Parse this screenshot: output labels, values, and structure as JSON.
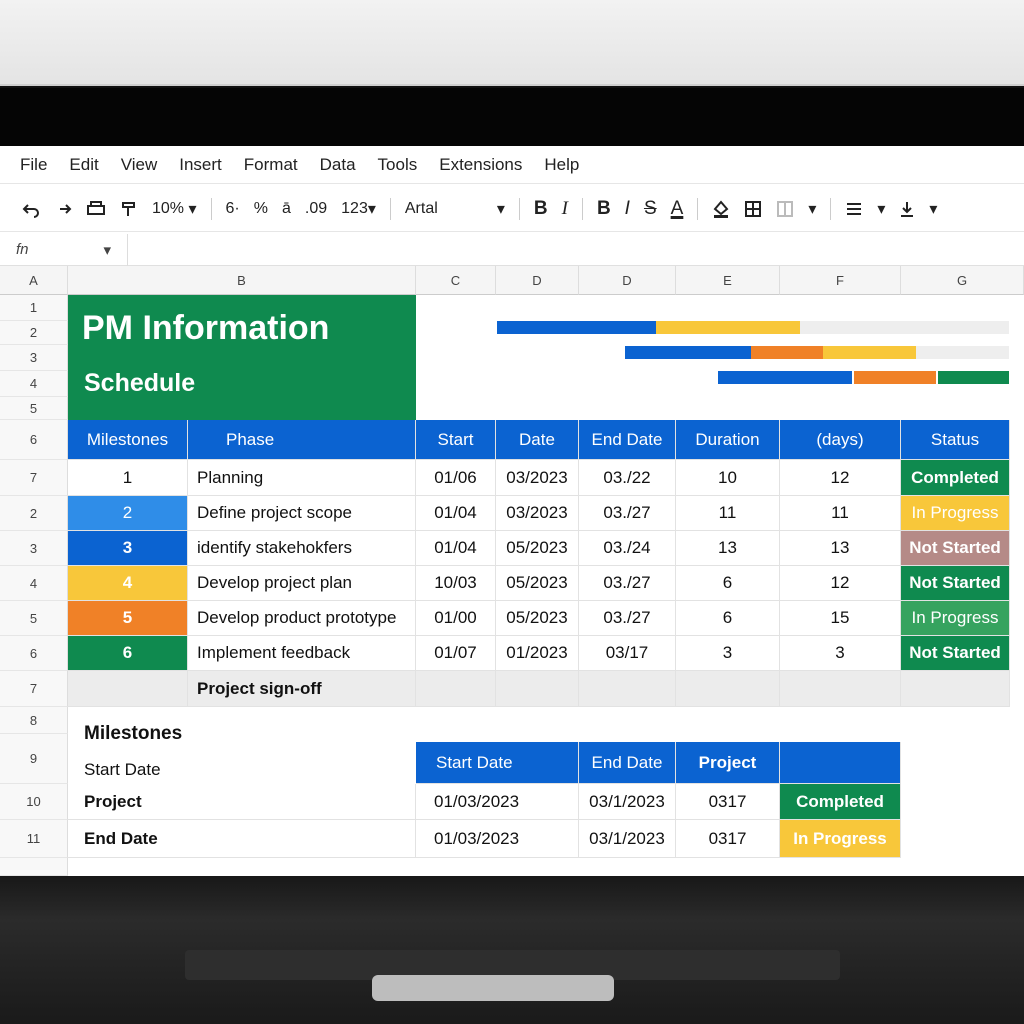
{
  "menu": [
    "File",
    "Edit",
    "View",
    "Insert",
    "Format",
    "Data",
    "Tools",
    "Extensions",
    "Help"
  ],
  "toolbar": {
    "undo_icon": "undo-icon",
    "redo_icon": "redo-icon",
    "zoom": "10%",
    "decimal_dec": "6·",
    "percent": "%",
    "currency": "ā",
    "decimal_inc": ".09",
    "format": "123",
    "font": "Artal",
    "bold": "B",
    "italic": "I",
    "bold2": "B",
    "italic2": "I",
    "strike": "S",
    "textcolor": "A"
  },
  "formula": {
    "namebox": "fn"
  },
  "columns": [
    "A",
    "B",
    "C",
    "D",
    "D",
    "E",
    "F",
    "G"
  ],
  "rows": [
    "1",
    "2",
    "3",
    "4",
    "5",
    "6",
    "7",
    "2",
    "3",
    "4",
    "5",
    "6",
    "7",
    "8",
    "9",
    "10",
    "11"
  ],
  "banner": {
    "title": "PM Information",
    "subtitle": "Schedule"
  },
  "table": {
    "headers": [
      "Milestones",
      "Phase",
      "Start",
      "Date",
      "End Date",
      "Duration",
      "(days)",
      "Status"
    ],
    "rows": [
      {
        "num": "1",
        "phase": "Planning",
        "start": "01/06",
        "date": "03/2023",
        "end": "03./22",
        "dur": "10",
        "days": "12",
        "status": "Completed"
      },
      {
        "num": "2",
        "phase": "Define project scope",
        "start": "01/04",
        "date": "03/2023",
        "end": "03./27",
        "dur": "11",
        "days": "11",
        "status": "In Progress"
      },
      {
        "num": "3",
        "phase": "identify stakehokfers",
        "start": "01/04",
        "date": "05/2023",
        "end": "03./24",
        "dur": "13",
        "days": "13",
        "status": "Not Started"
      },
      {
        "num": "4",
        "phase": "Develop project plan",
        "start": "10/03",
        "date": "05/2023",
        "end": "03./27",
        "dur": "6",
        "days": "12",
        "status": "Not Started"
      },
      {
        "num": "5",
        "phase": "Develop product prototype",
        "start": "01/00",
        "date": "05/2023",
        "end": "03./27",
        "dur": "6",
        "days": "15",
        "status": "In Progress"
      },
      {
        "num": "6",
        "phase": "Implement feedback",
        "start": "01/07",
        "date": "01/2023",
        "end": "03/17",
        "dur": "3",
        "days": "3",
        "status": "Not Started"
      }
    ],
    "signoff": "Project sign-off"
  },
  "summary": {
    "title": "Milestones",
    "label_start": "Start Date",
    "headers": [
      "Start Date",
      "End Date",
      "Project"
    ],
    "rows": [
      {
        "label": "Project",
        "start": "01/03/2023",
        "end": "03/1/2023",
        "proj": "0317",
        "status": "Completed"
      },
      {
        "label": "End Date",
        "start": "01/03/2023",
        "end": "03/1/2023",
        "proj": "0317",
        "status": "In Progress"
      }
    ]
  },
  "colors": {
    "blue": "#0b63d1",
    "green": "#0f8a4f",
    "yellow": "#f8c73a",
    "orange": "#f08127"
  }
}
